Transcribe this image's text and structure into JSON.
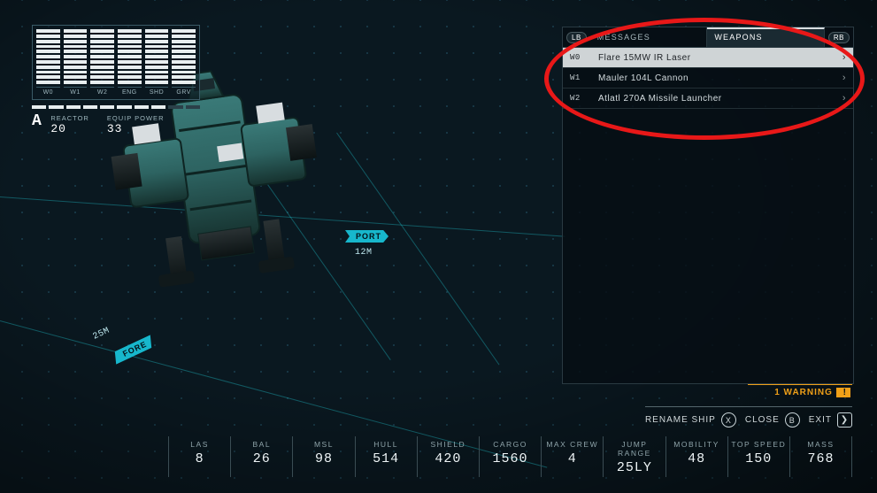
{
  "power": {
    "max_segments": 11,
    "gauges": [
      {
        "label": "W0",
        "filled": 11
      },
      {
        "label": "W1",
        "filled": 11
      },
      {
        "label": "W2",
        "filled": 11
      },
      {
        "label": "ENG",
        "filled": 11
      },
      {
        "label": "SHD",
        "filled": 11
      },
      {
        "label": "GRV",
        "filled": 11
      }
    ],
    "reactor_label": "REACTOR",
    "reactor_value": "20",
    "equip_label": "EQUIP POWER",
    "equip_value": "33"
  },
  "measurements": {
    "port_label": "PORT",
    "port_value": "12M",
    "fore_label": "FORE",
    "fore_value": "25M"
  },
  "side_panel": {
    "lb": "LB",
    "rb": "RB",
    "tabs": [
      {
        "label": "MESSAGES",
        "active": false
      },
      {
        "label": "WEAPONS",
        "active": true
      }
    ],
    "weapons": [
      {
        "slot": "W0",
        "name": "Flare 15MW IR Laser",
        "selected": true
      },
      {
        "slot": "W1",
        "name": "Mauler 104L Cannon",
        "selected": false
      },
      {
        "slot": "W2",
        "name": "Atlatl 270A Missile Launcher",
        "selected": false
      }
    ]
  },
  "warning_text": "1 WARNING",
  "actions": {
    "rename": {
      "label": "RENAME SHIP",
      "key": "X"
    },
    "close": {
      "label": "CLOSE",
      "key": "B"
    },
    "exit": {
      "label": "EXIT"
    }
  },
  "stats": [
    {
      "label": "LAS",
      "value": "8"
    },
    {
      "label": "BAL",
      "value": "26"
    },
    {
      "label": "MSL",
      "value": "98"
    },
    {
      "label": "HULL",
      "value": "514"
    },
    {
      "label": "SHIELD",
      "value": "420"
    },
    {
      "label": "CARGO",
      "value": "1560"
    },
    {
      "label": "MAX CREW",
      "value": "4"
    },
    {
      "label": "JUMP RANGE",
      "value": "25LY"
    },
    {
      "label": "MOBILITY",
      "value": "48"
    },
    {
      "label": "TOP SPEED",
      "value": "150"
    },
    {
      "label": "MASS",
      "value": "768"
    }
  ]
}
